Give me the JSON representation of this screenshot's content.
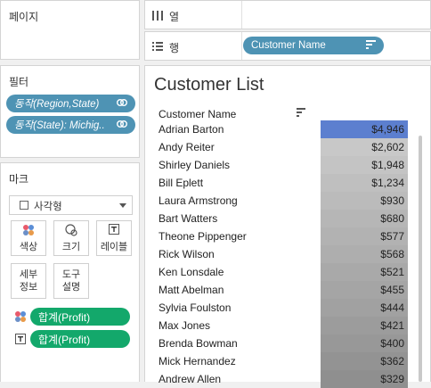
{
  "pages": {
    "title": "페이지"
  },
  "shelves": {
    "columns": {
      "icon": "columns-icon",
      "label": "열"
    },
    "rows": {
      "icon": "rows-icon",
      "label": "행",
      "pill": "Customer Name"
    }
  },
  "filters": {
    "title": "필터",
    "items": [
      {
        "label": "동작(Region,State)"
      },
      {
        "label": "동작(State): Michig.."
      }
    ]
  },
  "marks": {
    "title": "마크",
    "mark_type": "사각형",
    "cards": [
      {
        "name": "color",
        "icon": "color-dots-icon",
        "label": "색상"
      },
      {
        "name": "size",
        "icon": "size-icon",
        "label": "크기"
      },
      {
        "name": "label",
        "icon": "text-label-icon",
        "label": "레이블"
      },
      {
        "name": "detail",
        "label": "세부\n정보"
      },
      {
        "name": "tooltip",
        "label": "도구\n설명"
      }
    ],
    "fields": [
      {
        "icon": "color-dots-icon",
        "label": "합계(Profit)"
      },
      {
        "icon": "text-label-icon",
        "label": "합계(Profit)"
      }
    ]
  },
  "view": {
    "title": "Customer List",
    "header": "Customer Name",
    "colors": {
      "top": "#5c7fcf",
      "high": "#c8c8c8",
      "low": "#8f8f8f"
    },
    "rows": [
      {
        "name": "Adrian Barton",
        "value": "$4,946"
      },
      {
        "name": "Andy Reiter",
        "value": "$2,602"
      },
      {
        "name": "Shirley Daniels",
        "value": "$1,948"
      },
      {
        "name": "Bill Eplett",
        "value": "$1,234"
      },
      {
        "name": "Laura Armstrong",
        "value": "$930"
      },
      {
        "name": "Bart Watters",
        "value": "$680"
      },
      {
        "name": "Theone Pippenger",
        "value": "$577"
      },
      {
        "name": "Rick Wilson",
        "value": "$568"
      },
      {
        "name": "Ken Lonsdale",
        "value": "$521"
      },
      {
        "name": "Matt Abelman",
        "value": "$455"
      },
      {
        "name": "Sylvia Foulston",
        "value": "$444"
      },
      {
        "name": "Max Jones",
        "value": "$421"
      },
      {
        "name": "Brenda Bowman",
        "value": "$400"
      },
      {
        "name": "Mick Hernandez",
        "value": "$362"
      },
      {
        "name": "Andrew Allen",
        "value": "$329"
      }
    ]
  }
}
